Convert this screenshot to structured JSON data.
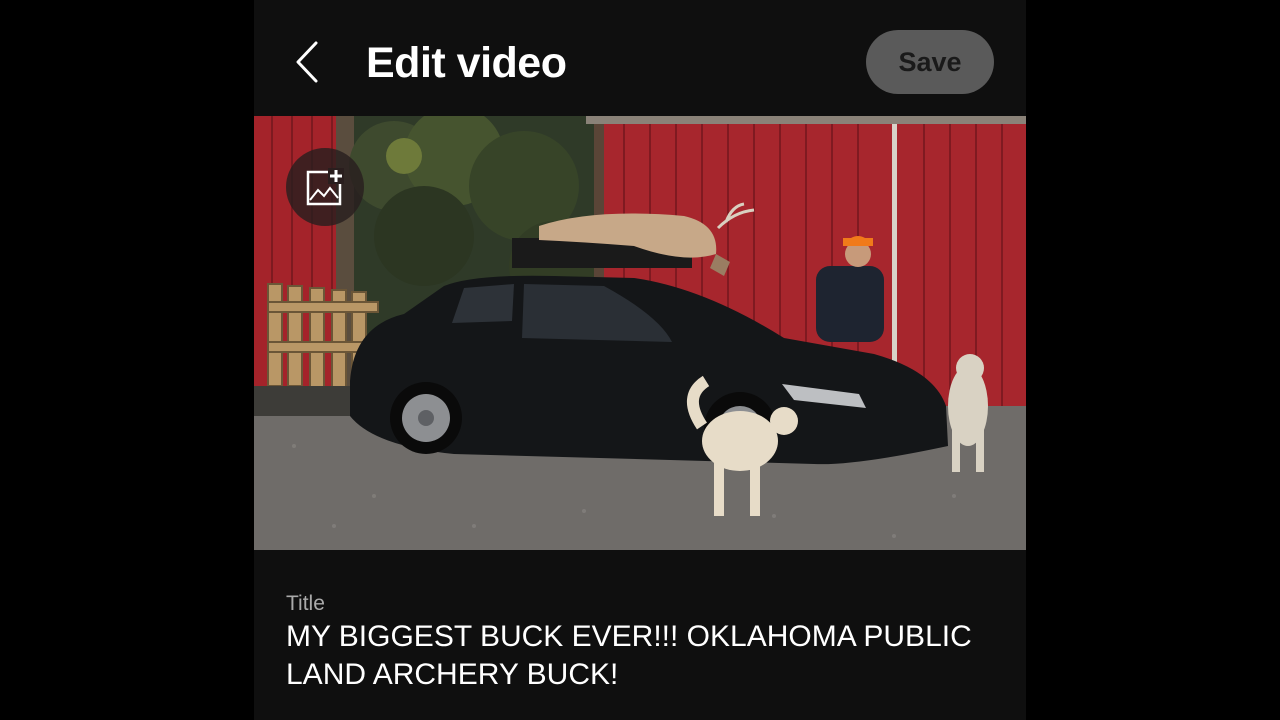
{
  "header": {
    "title": "Edit video",
    "save_label": "Save",
    "back_icon": "chevron-left-icon"
  },
  "thumbnail": {
    "edit_icon": "add-image-icon",
    "description_colors": {
      "barn": "#a4232a",
      "car": "#141618",
      "gravel": "#6f6c69",
      "hat": "#f07a1a"
    }
  },
  "details": {
    "title_label": "Title",
    "title_value": "MY BIGGEST BUCK EVER!!! OKLAHOMA PUBLIC LAND ARCHERY BUCK!"
  },
  "colors": {
    "background": "#0f0f0f",
    "text_primary": "#ffffff",
    "text_secondary": "#aaaaaa",
    "save_bg": "#5a5a5a"
  }
}
